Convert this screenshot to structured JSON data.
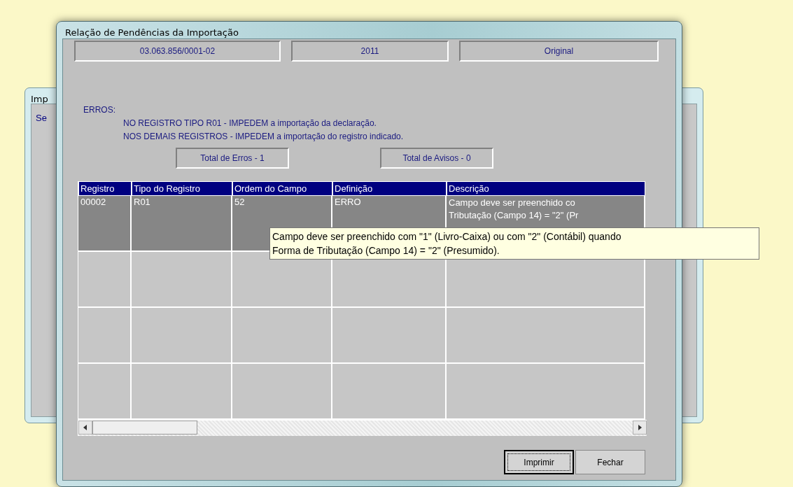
{
  "background_window": {
    "title": "Imp",
    "label": "Se"
  },
  "dialog": {
    "title": "Relação de Pendências da Importação"
  },
  "header_fields": [
    "03.063.856/0001-02",
    "2011",
    "Original"
  ],
  "errors": {
    "label": "ERROS:",
    "lines": [
      "NO REGISTRO TIPO R01 -  IMPEDEM a importação da declaração.",
      "NOS DEMAIS REGISTROS -  IMPEDEM a importação do registro indicado."
    ]
  },
  "totals": [
    "Total de Erros - 1",
    "Total de Avisos - 0"
  ],
  "table": {
    "columns": [
      "Registro",
      "Tipo do Registro",
      "Ordem do Campo",
      "Definição",
      "Descrição"
    ],
    "rows": [
      {
        "selected": true,
        "cells": [
          "00002",
          "R01",
          "52",
          "ERRO"
        ],
        "description_lines": [
          "Campo deve ser preenchido co",
          "Tributação (Campo 14) = \"2\" (Pr"
        ]
      }
    ]
  },
  "tooltip": {
    "lines": [
      "Campo deve ser preenchido com \"1\" (Livro-Caixa) ou com \"2\" (Contábil) quando",
      "Forma de Tributação (Campo 14) = \"2\" (Presumido)."
    ]
  },
  "buttons": [
    {
      "label": "Imprimir",
      "focused": true
    },
    {
      "label": "Fechar",
      "focused": false
    }
  ]
}
